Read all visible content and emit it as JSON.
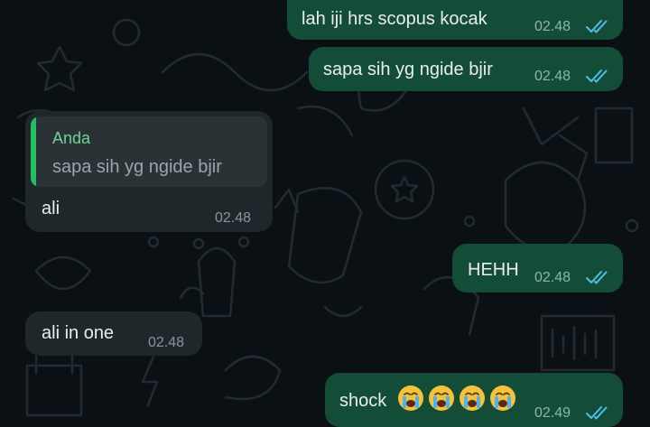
{
  "messages": [
    {
      "direction": "outgoing",
      "text": "lah iji hrs scopus kocak",
      "time": "02.48",
      "status_icon": "double-check-icon"
    },
    {
      "direction": "outgoing",
      "text": "sapa sih yg ngide bjir",
      "time": "02.48",
      "status_icon": "double-check-icon"
    },
    {
      "direction": "incoming",
      "reply_to": {
        "author": "Anda",
        "text": "sapa sih yg ngide bjir"
      },
      "text": "ali",
      "time": "02.48"
    },
    {
      "direction": "outgoing",
      "text": "HEHH",
      "time": "02.48",
      "status_icon": "double-check-icon"
    },
    {
      "direction": "incoming",
      "text": "ali in one",
      "time": "02.48"
    },
    {
      "direction": "outgoing",
      "text": "shock",
      "emoji": [
        "loudly-crying-face",
        "loudly-crying-face",
        "loudly-crying-face",
        "loudly-crying-face"
      ],
      "time": "02.49",
      "status_icon": "double-check-icon"
    }
  ],
  "colors": {
    "background": "#0b1014",
    "outgoing_bubble": "#134d37",
    "incoming_bubble": "#1f272a",
    "quote_accent": "#21c063",
    "read_tick": "#53bdeb"
  }
}
